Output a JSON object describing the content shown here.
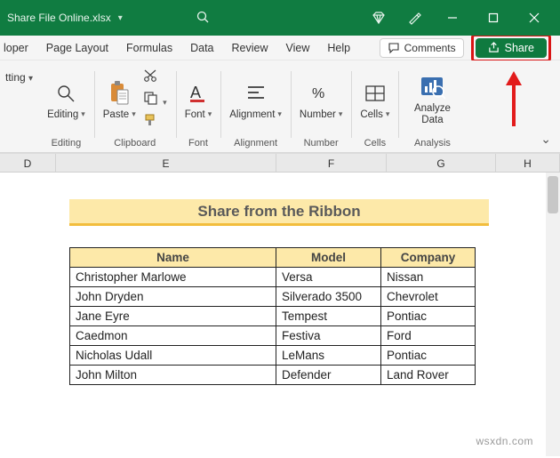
{
  "title": "Share File Online.xlsx",
  "tabs": [
    "loper",
    "Page Layout",
    "Formulas",
    "Data",
    "Review",
    "View",
    "Help"
  ],
  "comments_label": "Comments",
  "share_label": "Share",
  "truncated_cmd": "tting",
  "groups": {
    "editing": {
      "label": "Editing",
      "btn": "Editing"
    },
    "clipboard": {
      "label": "Clipboard",
      "btn": "Paste"
    },
    "font": {
      "label": "Font",
      "btn": "Font"
    },
    "alignment": {
      "label": "Alignment",
      "btn": "Alignment"
    },
    "number": {
      "label": "Number",
      "btn": "Number"
    },
    "cells": {
      "label": "Cells",
      "btn": "Cells"
    },
    "analysis": {
      "label": "Analysis",
      "btn": "Analyze Data"
    }
  },
  "columns": [
    "D",
    "E",
    "F",
    "G",
    "H"
  ],
  "banner": "Share from the Ribbon",
  "table": {
    "headers": [
      "Name",
      "Model",
      "Company"
    ],
    "rows": [
      [
        "Christopher Marlowe",
        "Versa",
        "Nissan"
      ],
      [
        "John Dryden",
        "Silverado 3500",
        "Chevrolet"
      ],
      [
        "Jane Eyre",
        "Tempest",
        "Pontiac"
      ],
      [
        "Caedmon",
        "Festiva",
        "Ford"
      ],
      [
        "Nicholas Udall",
        "LeMans",
        "Pontiac"
      ],
      [
        "John Milton",
        "Defender",
        "Land Rover"
      ]
    ]
  },
  "watermark": "wsxdn.com"
}
